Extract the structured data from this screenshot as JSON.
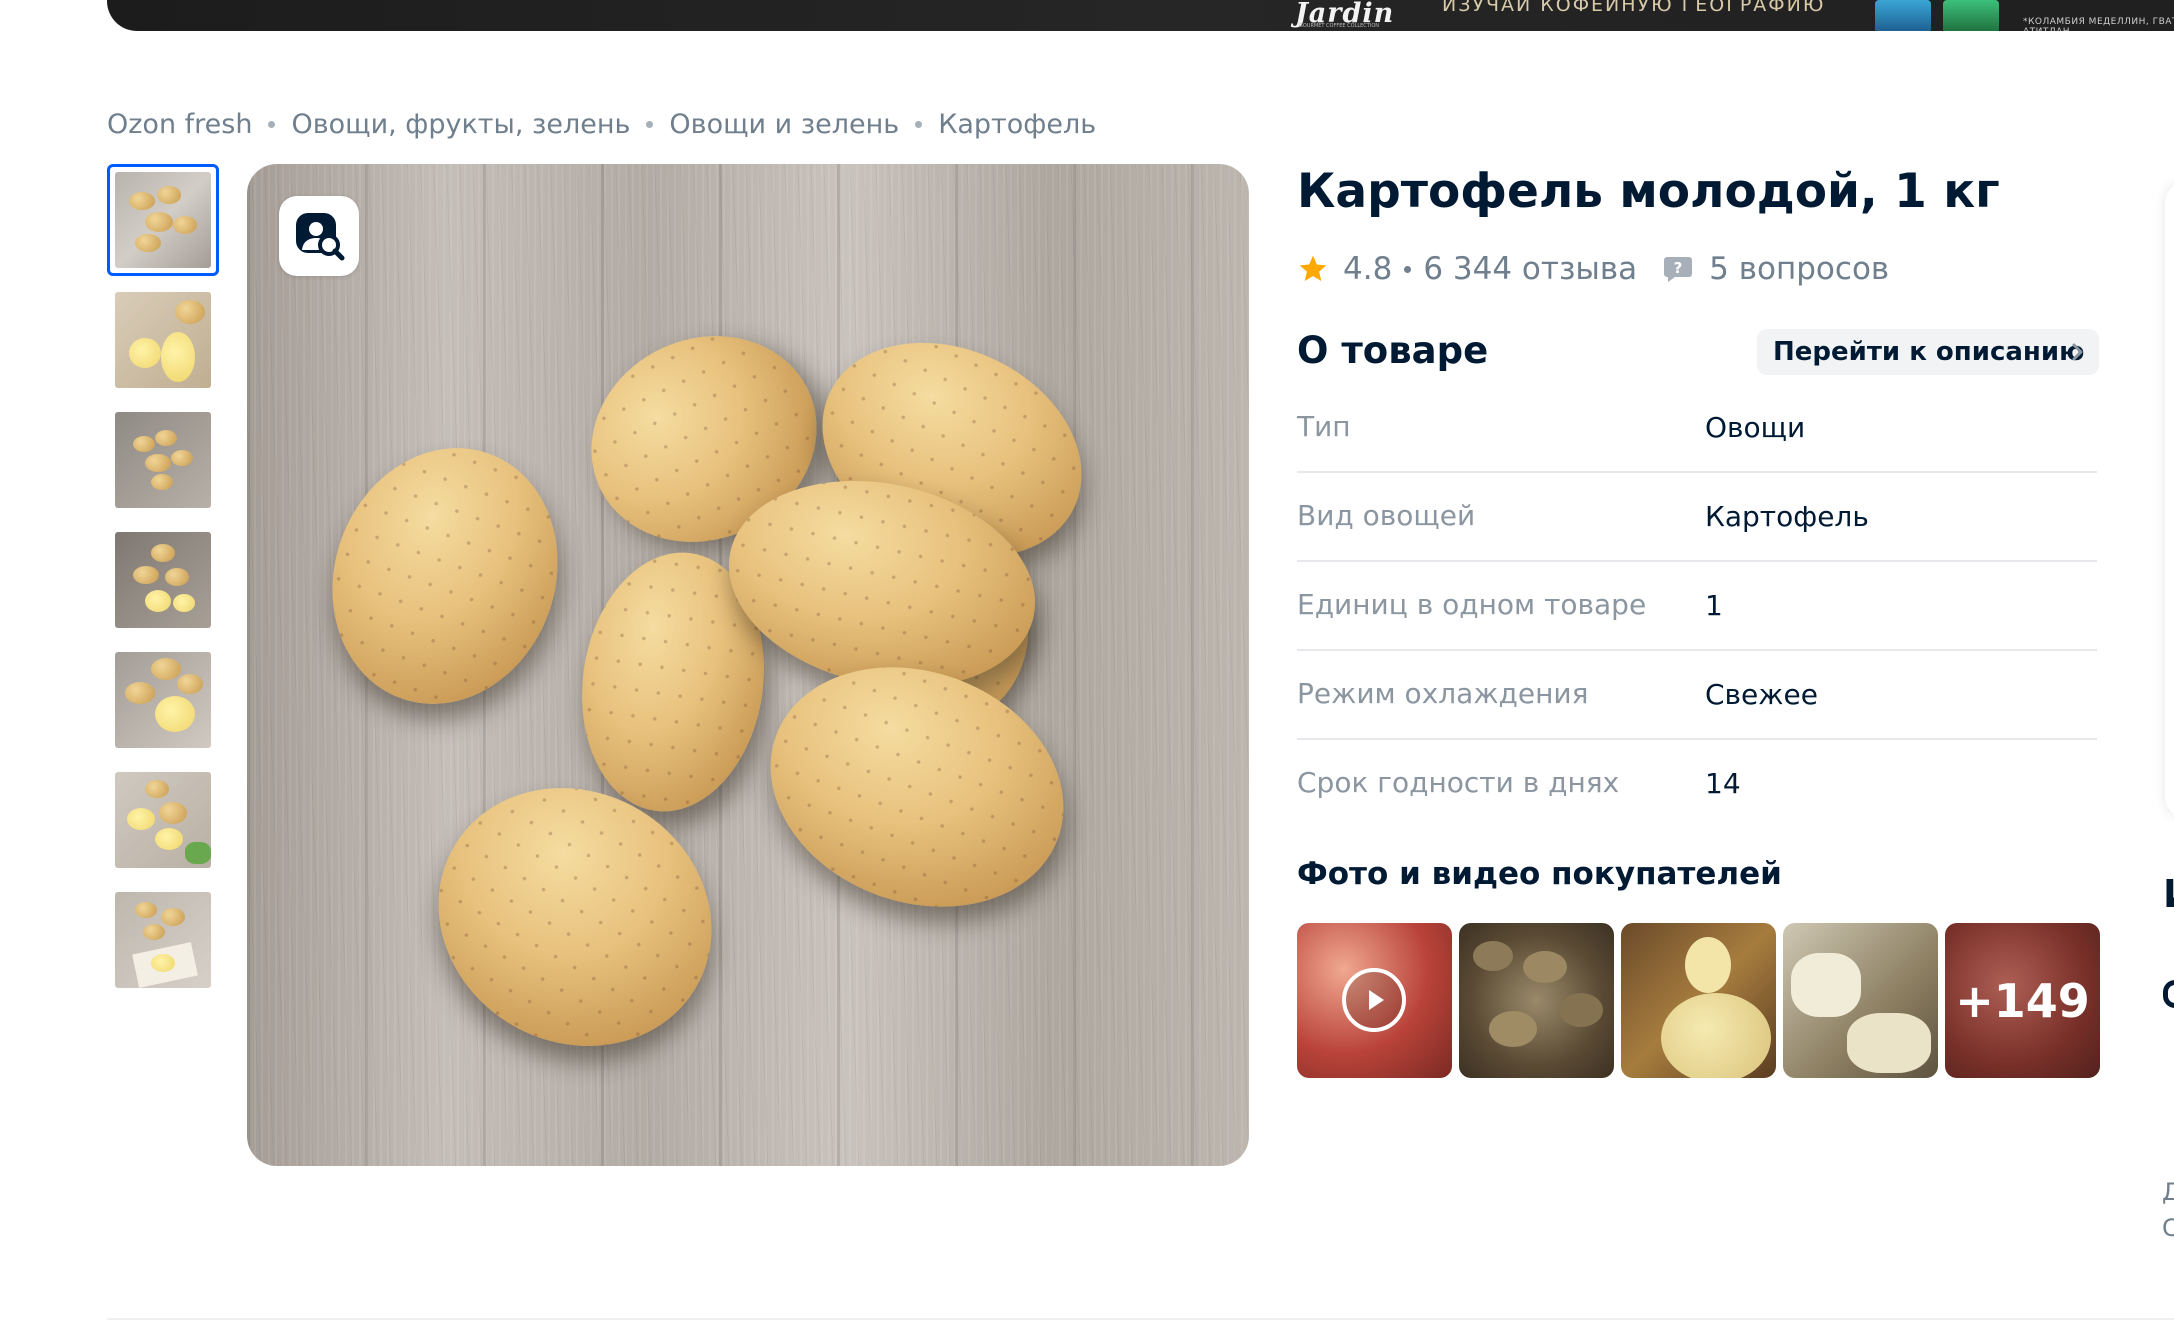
{
  "banner": {
    "brand": "Jardin",
    "brand_sub": "GOURMET COFFEE COLLECTION",
    "tagline": "ИЗУЧАЙ КОФЕЙНУЮ ГЕОГРАФИЮ",
    "note": "*КОЛАМБИЯ МЕДЕЛЛИН, ГВАТЕМАЛА АТИТЛАН"
  },
  "breadcrumbs": [
    "Ozon fresh",
    "Овощи, фрукты, зелень",
    "Овощи и зелень",
    "Картофель"
  ],
  "product": {
    "title": "Картофель молодой, 1 кг",
    "rating": "4.8",
    "reviews": "6 344 отзыва",
    "questions": "5 вопросов"
  },
  "about": {
    "title": "О товаре",
    "goto_label": "Перейти к описанию",
    "properties": [
      {
        "key": "Тип",
        "value": "Овощи"
      },
      {
        "key": "Вид овощей",
        "value": "Картофель"
      },
      {
        "key": "Единиц в одном товаре",
        "value": "1"
      },
      {
        "key": "Режим охлаждения",
        "value": "Свежее"
      },
      {
        "key": "Срок годности в днях",
        "value": "14"
      }
    ]
  },
  "customer_media": {
    "title": "Фото и видео покупателей",
    "more_count": "+149"
  },
  "side_fragments": {
    "a": "И",
    "b": "Д",
    "c": "С"
  },
  "colors": {
    "accent": "#005bff",
    "text_primary": "#001a34",
    "text_secondary": "#707f8d",
    "star": "#ffa800"
  },
  "icons": {
    "zoom": "search-person-icon",
    "star": "star-icon",
    "question": "question-bubble-icon",
    "chevron": "chevron-right-icon",
    "play": "play-icon"
  }
}
